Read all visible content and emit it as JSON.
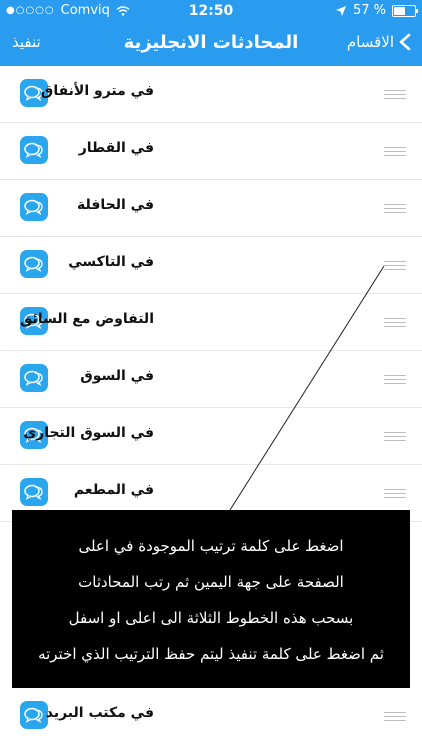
{
  "status": {
    "carrier": "Comviq",
    "time": "12:50",
    "battery_percent": "57 %",
    "battery_level": 0.57
  },
  "nav": {
    "title": "المحادثات الانجليزية",
    "back_label": "الاقسام",
    "apply_label": "تنفيذ"
  },
  "items": [
    {
      "label": "في مترو الأنفاق",
      "icon": "chat-bubbles-icon"
    },
    {
      "label": "في القطار",
      "icon": "chat-bubbles-icon"
    },
    {
      "label": "في الحافلة",
      "icon": "chat-bubbles-icon"
    },
    {
      "label": "في التاكسي",
      "icon": "chat-bubbles-icon"
    },
    {
      "label": "التفاوض مع السائق",
      "icon": "chat-bubbles-icon"
    },
    {
      "label": "في السوق",
      "icon": "chat-bubbles-icon"
    },
    {
      "label": "في السوق التجاري",
      "icon": "chat-bubbles-icon"
    },
    {
      "label": "في المطعم",
      "icon": "chat-bubbles-icon"
    }
  ],
  "last_item": {
    "label": "في مكتب البريد",
    "icon": "chat-bubbles-icon"
  },
  "tooltip": {
    "line1": "اضغط على كلمة ترتيب الموجودة في اعلى",
    "line2": "الصفحة على جهة اليمين ثم رتب المحادثات",
    "line3": "بسحب هذه الخطوط الثلاثة الى اعلى او اسفل",
    "line4": "ثم اضغط على كلمة تنفيذ ليتم حفظ الترتيب الذي اخترته"
  },
  "colors": {
    "accent": "#2a9cf0",
    "icon_bg": "#2aa6ef"
  }
}
